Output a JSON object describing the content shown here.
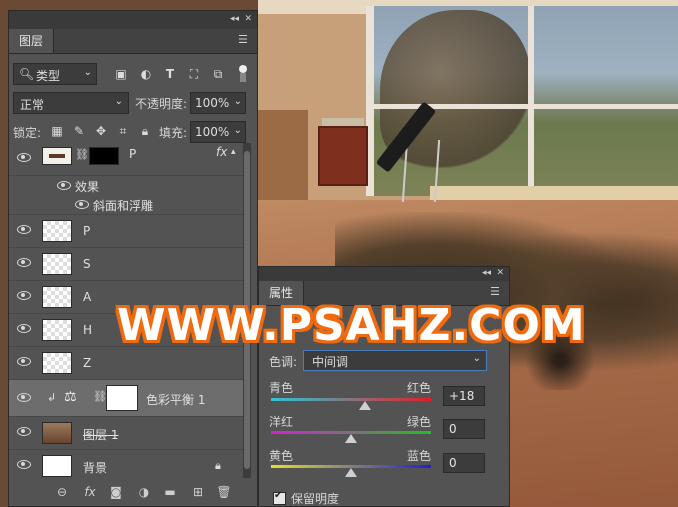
{
  "layers_panel": {
    "tab": "图层",
    "filter": "类型",
    "blend_mode": "正常",
    "opacity_label": "不透明度:",
    "opacity_value": "100%",
    "lock_label": "锁定:",
    "fill_label": "填充:",
    "fill_value": "100%",
    "layers": [
      {
        "name": "P",
        "type": "styled",
        "fx": "fx"
      },
      {
        "name": "效果",
        "type": "effect-group"
      },
      {
        "name": "斜面和浮雕",
        "type": "effect"
      },
      {
        "name": "P",
        "type": "layer"
      },
      {
        "name": "S",
        "type": "layer"
      },
      {
        "name": "A",
        "type": "layer"
      },
      {
        "name": "H",
        "type": "layer"
      },
      {
        "name": "Z",
        "type": "layer"
      },
      {
        "name": "色彩平衡 1",
        "type": "adjustment"
      },
      {
        "name": "图层 1",
        "type": "layer"
      },
      {
        "name": "背景",
        "type": "background"
      }
    ]
  },
  "properties_panel": {
    "tab": "属性",
    "tone_label": "色调:",
    "tone_value": "中间调",
    "sliders": [
      {
        "left": "青色",
        "right": "红色",
        "value": "+18",
        "position": 0.59
      },
      {
        "left": "洋红",
        "right": "绿色",
        "value": "0",
        "position": 0.5
      },
      {
        "left": "黄色",
        "right": "蓝色",
        "value": "0",
        "position": 0.5
      }
    ],
    "preserve_luminosity": "保留明度"
  },
  "watermark": "WWW.PSAHZ.COM",
  "colors": {
    "accent": "#f06a10",
    "panel": "#535353",
    "field": "#3c3c3c"
  }
}
